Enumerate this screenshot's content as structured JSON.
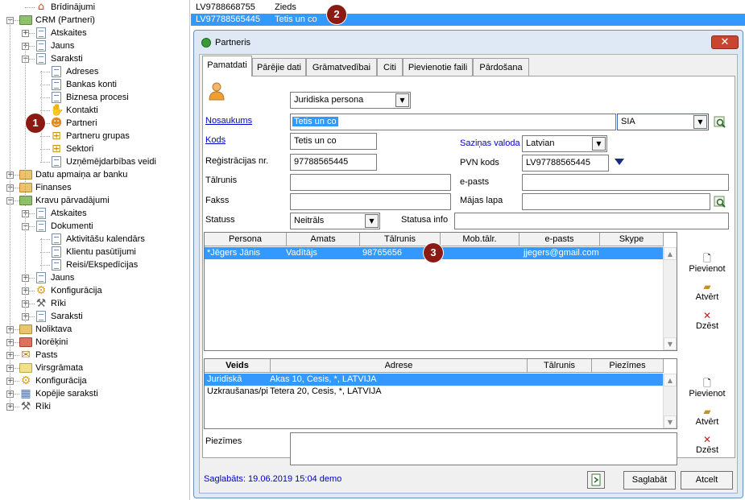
{
  "tree": [
    {
      "label": "Brīdinājumi",
      "icon": "house-icon"
    },
    {
      "label": "CRM (Partneri)",
      "icon": "folder-icon"
    },
    {
      "label": "Atskaites",
      "icon": "document-icon"
    },
    {
      "label": "Jauns",
      "icon": "new-document-icon"
    },
    {
      "label": "Saraksti",
      "icon": "document-icon"
    },
    {
      "label": "Adreses",
      "icon": "document-icon"
    },
    {
      "label": "Bankas konti",
      "icon": "document-icon"
    },
    {
      "label": "Biznesa procesi",
      "icon": "document-icon"
    },
    {
      "label": "Kontakti",
      "icon": "handshake-icon"
    },
    {
      "label": "Partneri",
      "icon": "partner-icon"
    },
    {
      "label": "Partneru grupas",
      "icon": "group-icon"
    },
    {
      "label": "Sektori",
      "icon": "group-icon"
    },
    {
      "label": "Uzņēmējdarbības veidi",
      "icon": "document-icon"
    },
    {
      "label": "Datu apmaiņa ar banku",
      "icon": "folder-icon"
    },
    {
      "label": "Finanses",
      "icon": "folder-icon"
    },
    {
      "label": "Kravu pārvadājumi",
      "icon": "folder-icon"
    },
    {
      "label": "Atskaites",
      "icon": "document-icon"
    },
    {
      "label": "Dokumenti",
      "icon": "document-icon"
    },
    {
      "label": "Aktivitāšu kalendārs",
      "icon": "document-icon"
    },
    {
      "label": "Klientu pasūtījumi",
      "icon": "document-icon"
    },
    {
      "label": "Reisi/Ekspedīcijas",
      "icon": "document-icon"
    },
    {
      "label": "Jauns",
      "icon": "new-document-icon"
    },
    {
      "label": "Konfigurācija",
      "icon": "gear-icon"
    },
    {
      "label": "Rīki",
      "icon": "tools-icon"
    },
    {
      "label": "Saraksti",
      "icon": "document-icon"
    },
    {
      "label": "Noliktava",
      "icon": "folder-icon"
    },
    {
      "label": "Norēķini",
      "icon": "folder-icon"
    },
    {
      "label": "Pasts",
      "icon": "envelope-icon"
    },
    {
      "label": "Virsgrāmata",
      "icon": "folder-icon"
    },
    {
      "label": "Konfigurācija",
      "icon": "gear-icon"
    },
    {
      "label": "Kopējie saraksti",
      "icon": "grid-icon"
    },
    {
      "label": "Rīki",
      "icon": "tools-icon"
    }
  ],
  "badges": [
    "1",
    "2",
    "3"
  ],
  "toplist": [
    {
      "code": "LV9788668755",
      "name": "Zieds"
    },
    {
      "code": "LV97788565445",
      "name": "Tetis un co"
    }
  ],
  "window": {
    "title": "Partneris",
    "close_symbol": "✕",
    "tabs": [
      "Pamatdati",
      "Pārējie dati",
      "Grāmatvedībai",
      "Citi",
      "Pievienotie faili",
      "Pārdošana"
    ]
  },
  "form": {
    "type_value": "Juridiska persona",
    "name_label": "Nosaukums",
    "name_value": "Tetis un co",
    "legal_form": "SIA",
    "code_label": "Kods",
    "code_value": "Tetis un co",
    "lang_label": "Saziņas valoda",
    "lang_value": "Latvian",
    "reg_label": "Reģistrācijas nr.",
    "reg_value": "97788565445",
    "vat_label": "PVN kods",
    "vat_value": "LV97788565445",
    "phone_label": "Tālrunis",
    "phone_value": "",
    "email_label": "e-pasts",
    "email_value": "",
    "fax_label": "Fakss",
    "fax_value": "",
    "web_label": "Mājas lapa",
    "web_value": "",
    "status_label": "Statuss",
    "status_value": "Neitrāls",
    "status_info_label": "Statusa info",
    "status_info_value": "",
    "notes_label": "Piezīmes",
    "notes_value": ""
  },
  "contacts": {
    "headers": [
      "Persona",
      "Amats",
      "Tālrunis",
      "Mob.tālr.",
      "e-pasts",
      "Skype"
    ],
    "rows": [
      [
        "*Jēgers Jānis",
        "Vadītājs",
        "98765656",
        "",
        "jjegers@gmail.com",
        ""
      ]
    ]
  },
  "addresses": {
    "headers": [
      "Veids",
      "Adrese",
      "Tālrunis",
      "Piezīmes"
    ],
    "rows": [
      [
        "Juridiskā",
        "Akas 10, Cesis, *, LATVIJA",
        "",
        ""
      ],
      [
        "Uzkraušanas/pi",
        "Tetera 20, Cesis, *, LATVIJA",
        "",
        ""
      ]
    ]
  },
  "side_buttons": {
    "add": "Pievienot",
    "open": "Atvērt",
    "delete": "Dzēst"
  },
  "footer": {
    "saved_text": "Saglabāts: 19.06.2019 15:04 demo",
    "save_button": "Saglabāt",
    "cancel_button": "Atcelt"
  }
}
